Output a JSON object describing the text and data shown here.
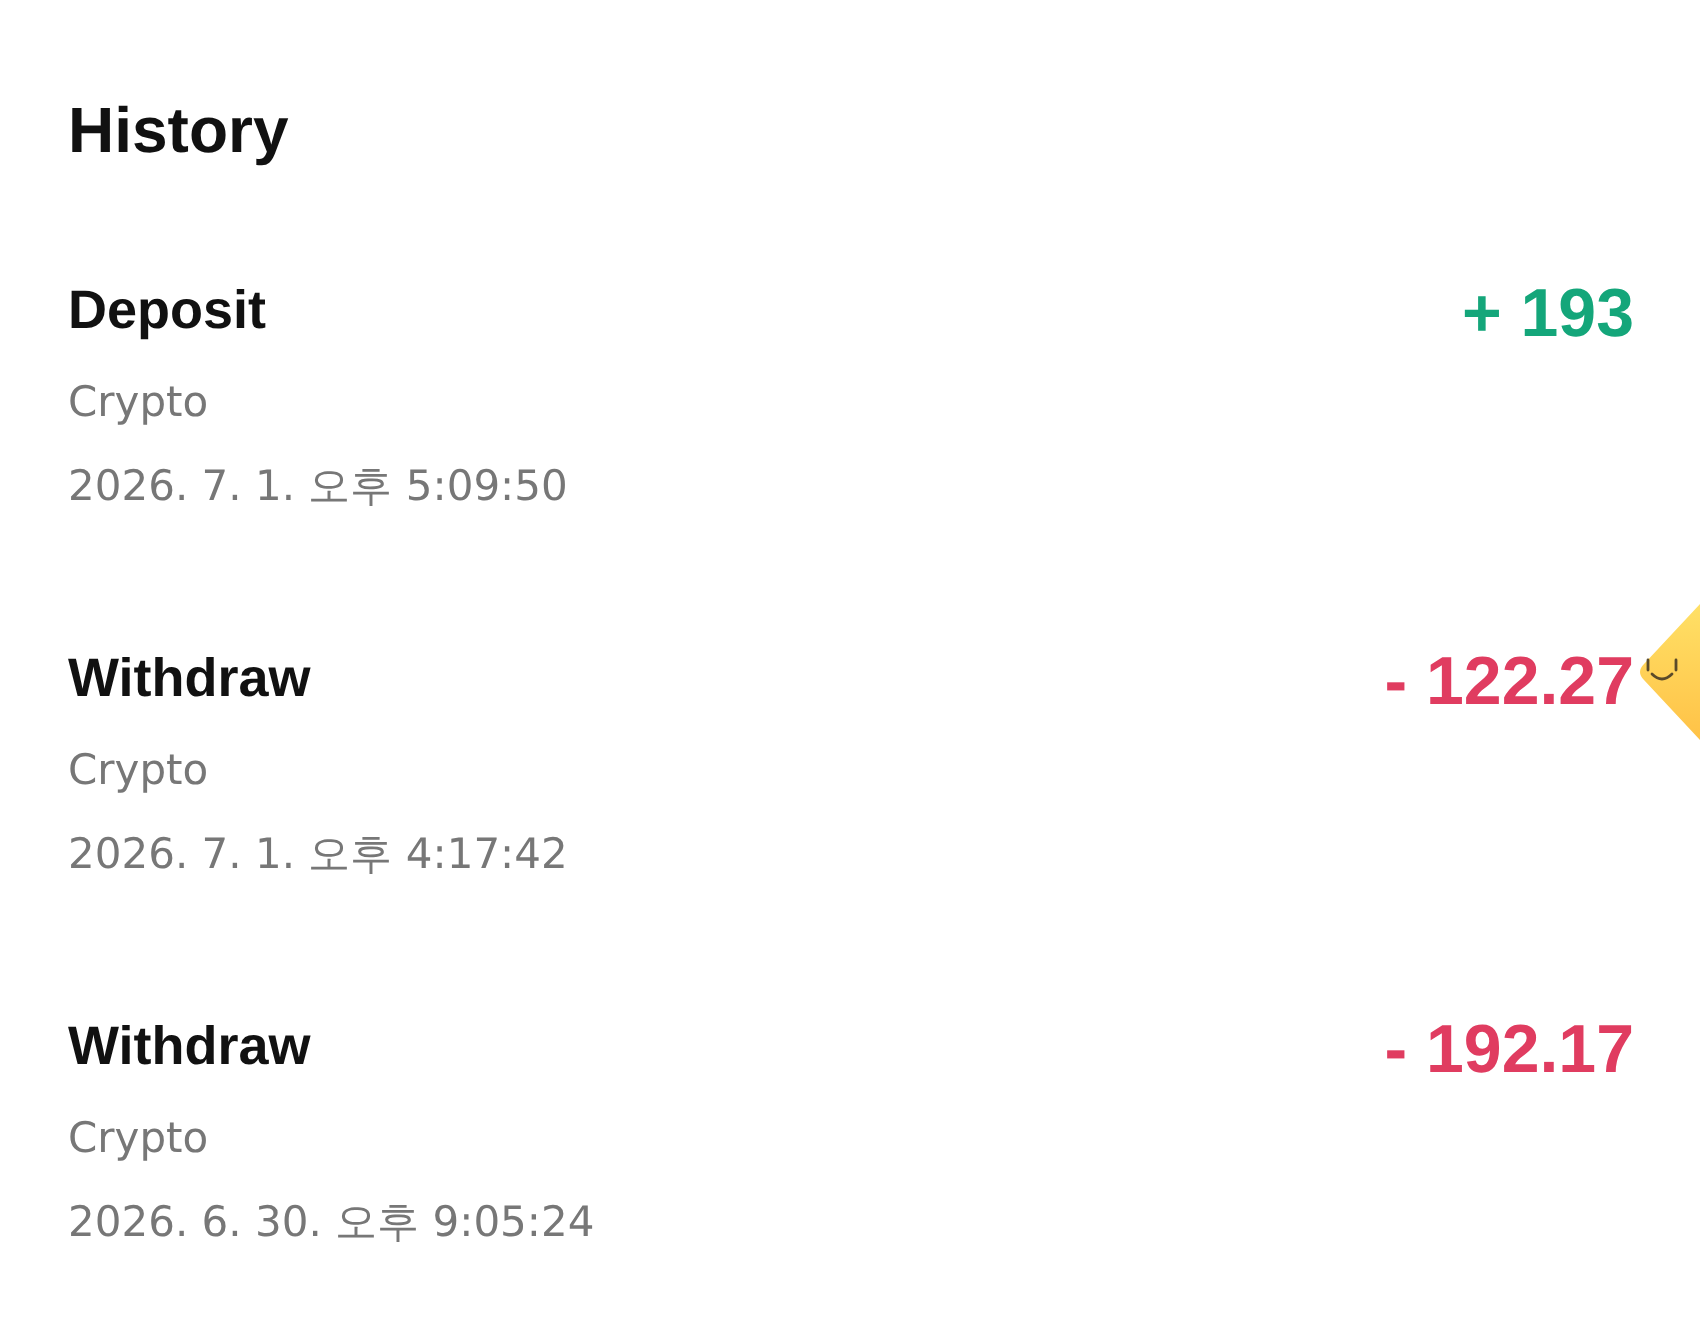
{
  "title": "History",
  "transactions": [
    {
      "kind": "deposit",
      "type": "Deposit",
      "method": "Crypto",
      "time": "2026. 7. 1. 오후 5:09:50",
      "amount": "+ 193"
    },
    {
      "kind": "withdraw",
      "type": "Withdraw",
      "method": "Crypto",
      "time": "2026. 7. 1. 오후 4:17:42",
      "amount": "- 122.27"
    },
    {
      "kind": "withdraw",
      "type": "Withdraw",
      "method": "Crypto",
      "time": "2026. 6. 30. 오후 9:05:24",
      "amount": "- 192.17"
    }
  ]
}
